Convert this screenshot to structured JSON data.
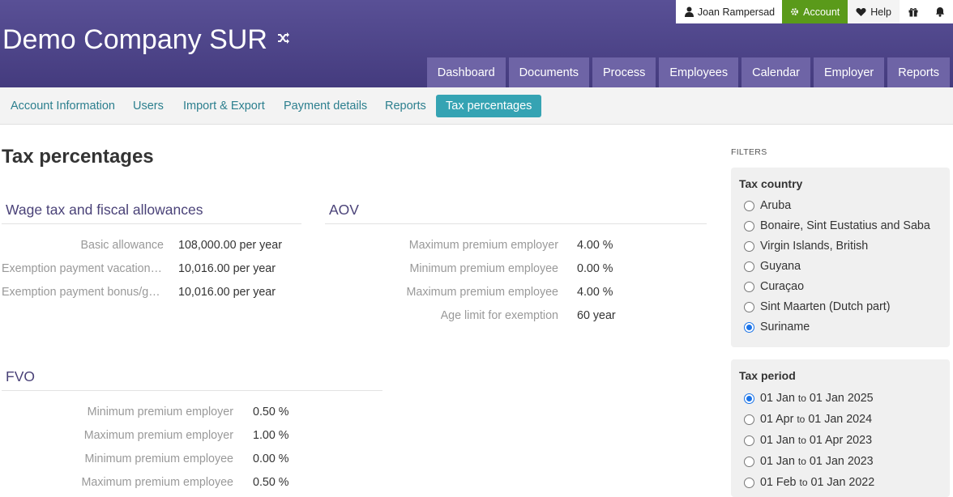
{
  "header": {
    "company": "Demo Company SUR",
    "user_name": "Joan Rampersad",
    "account_label": "Account",
    "help_label": "Help"
  },
  "main_nav": [
    "Dashboard",
    "Documents",
    "Process",
    "Employees",
    "Calendar",
    "Employer",
    "Reports"
  ],
  "sub_nav": {
    "tabs": [
      "Account Information",
      "Users",
      "Import & Export",
      "Payment details",
      "Reports",
      "Tax percentages"
    ],
    "active": "Tax percentages"
  },
  "page": {
    "title": "Tax percentages"
  },
  "wage_tax": {
    "heading": "Wage tax and fiscal allowances",
    "rows": [
      {
        "label": "Basic allowance",
        "value": "108,000.00 per year"
      },
      {
        "label": "Exemption payment vacation allowance",
        "value": "10,016.00 per year"
      },
      {
        "label": "Exemption payment bonus/gratuity",
        "value": "10,016.00 per year"
      }
    ]
  },
  "aov": {
    "heading": "AOV",
    "rows": [
      {
        "label": "Maximum premium employer",
        "value": "4.00 %"
      },
      {
        "label": "Minimum premium employee",
        "value": "0.00 %"
      },
      {
        "label": "Maximum premium employee",
        "value": "4.00 %"
      },
      {
        "label": "Age limit for exemption",
        "value": "60 year"
      }
    ]
  },
  "fvo": {
    "heading": "FVO",
    "rows": [
      {
        "label": "Minimum premium employer",
        "value": "0.50 %"
      },
      {
        "label": "Maximum premium employer",
        "value": "1.00 %"
      },
      {
        "label": "Minimum premium employee",
        "value": "0.00 %"
      },
      {
        "label": "Maximum premium employee",
        "value": "0.50 %"
      }
    ]
  },
  "filters": {
    "heading": "FILTERS",
    "tax_country": {
      "title": "Tax country",
      "options": [
        "Aruba",
        "Bonaire, Sint Eustatius and Saba",
        "Virgin Islands, British",
        "Guyana",
        "Curaçao",
        "Sint Maarten (Dutch part)",
        "Suriname"
      ],
      "selected": "Suriname"
    },
    "tax_period": {
      "title": "Tax period",
      "options": [
        {
          "from": "01 Jan",
          "sep": "to",
          "to": "01 Jan 2025"
        },
        {
          "from": "01 Apr",
          "sep": "to",
          "to": "01 Jan 2024"
        },
        {
          "from": "01 Jan",
          "sep": "to",
          "to": "01 Apr 2023"
        },
        {
          "from": "01 Jan",
          "sep": "to",
          "to": "01 Jan 2023"
        },
        {
          "from": "01 Feb",
          "sep": "to",
          "to": "01 Jan 2022"
        }
      ],
      "selected_index": 0
    }
  },
  "colors": {
    "header": "#4b4287",
    "nav_button": "#6e64a6",
    "account_green": "#5a9a1a",
    "active_tab": "#35a3b3",
    "section_heading": "#4a4278"
  },
  "icons": [
    "shuffle-icon",
    "user-icon",
    "gear-icon",
    "heart-icon",
    "gift-icon",
    "bell-icon"
  ]
}
